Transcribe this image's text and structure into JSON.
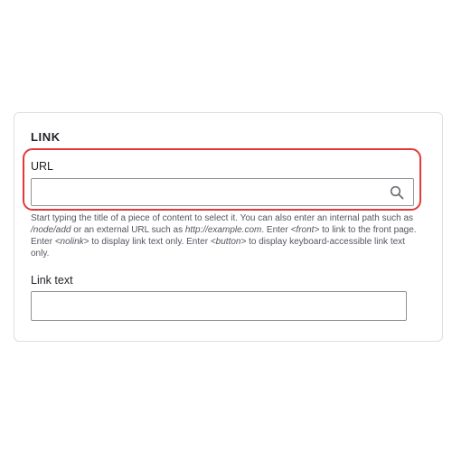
{
  "fieldset": {
    "legend": "LINK"
  },
  "url_field": {
    "label": "URL",
    "value": "",
    "icon": "search-icon",
    "description": [
      {
        "text": "Start typing the title of a piece of content to select it. You can also enter an internal path such as ",
        "italic": false
      },
      {
        "text": "/node/add",
        "italic": true
      },
      {
        "text": " or an external URL such as ",
        "italic": false
      },
      {
        "text": "http://example.com",
        "italic": true
      },
      {
        "text": ". Enter ",
        "italic": false
      },
      {
        "text": "<front>",
        "italic": true
      },
      {
        "text": " to link to the front page. Enter ",
        "italic": false
      },
      {
        "text": "<nolink>",
        "italic": true
      },
      {
        "text": " to display link text only. Enter ",
        "italic": false
      },
      {
        "text": "<button>",
        "italic": true
      },
      {
        "text": " to display keyboard-accessible link text only.",
        "italic": false
      }
    ]
  },
  "link_text_field": {
    "label": "Link text",
    "value": ""
  },
  "colors": {
    "highlight": "#e23a3a",
    "card_border": "#dedee4",
    "input_border": "#919297"
  }
}
